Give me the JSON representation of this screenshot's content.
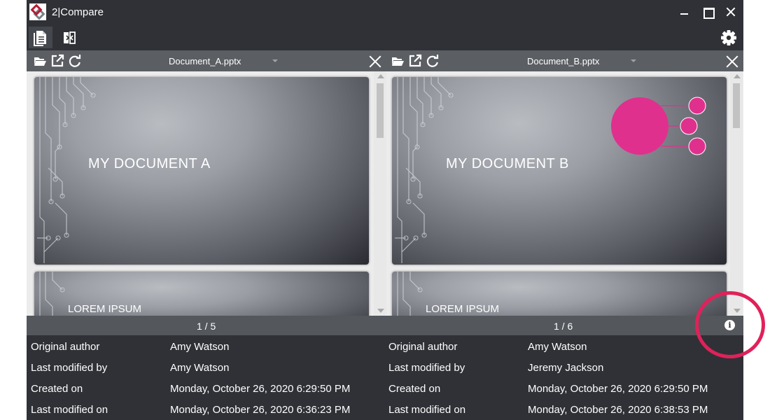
{
  "app": {
    "title": "2|Compare"
  },
  "toolbar": {
    "documents_icon": "documents-icon",
    "compare_icon": "compare-icon",
    "settings_icon": "gear-icon"
  },
  "panes": [
    {
      "filename": "Document_A.pptx",
      "slides": [
        {
          "title": "MY DOCUMENT A"
        },
        {
          "title": "LOREM IPSUM"
        }
      ],
      "page": "1 / 5"
    },
    {
      "filename": "Document_B.pptx",
      "slides": [
        {
          "title": "MY DOCUMENT B"
        },
        {
          "title": "LOREM IPSUM"
        }
      ],
      "page": "1 / 6"
    }
  ],
  "metadata": {
    "labels": [
      "Original author",
      "Last modified by",
      "Created on",
      "Last modified on"
    ],
    "a": [
      "Amy Watson",
      "Amy Watson",
      "Monday, October 26, 2020 6:29:50 PM",
      "Monday, October 26, 2020 6:36:23 PM"
    ],
    "b": [
      "Amy Watson",
      "Jeremy Jackson",
      "Monday, October 26, 2020 6:29:50 PM",
      "Monday, October 26, 2020 6:38:53 PM"
    ]
  },
  "info_button": {
    "label": "i"
  },
  "colors": {
    "accent": "#e0215a",
    "shape_pink": "#e0308e",
    "chrome": "#2f3136",
    "header": "#5b5e63"
  }
}
